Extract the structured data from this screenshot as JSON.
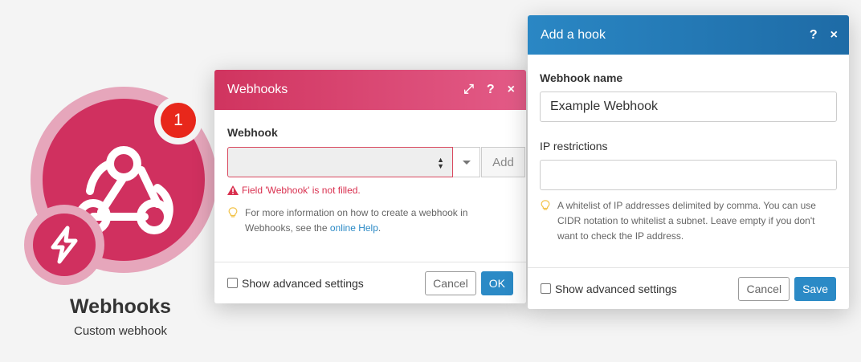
{
  "module": {
    "title": "Webhooks",
    "subtitle": "Custom webhook",
    "notification_count": "1",
    "color": "#d0305f",
    "icon": "webhook-icon"
  },
  "webhooks_dialog": {
    "title": "Webhooks",
    "header_buttons": {
      "expand": "⤢",
      "help": "?",
      "close": "×"
    },
    "webhook_label": "Webhook",
    "select_value": "",
    "add_button": "Add",
    "error_text": "Field 'Webhook' is not filled.",
    "hint_text_before_link": "For more information on how to create a webhook in Webhooks, see the ",
    "hint_link": "online Help",
    "hint_text_after_link": ".",
    "advanced_label": "Show advanced settings",
    "cancel_button": "Cancel",
    "ok_button": "OK"
  },
  "hook_dialog": {
    "title": "Add a hook",
    "header_buttons": {
      "help": "?",
      "close": "×"
    },
    "name_label": "Webhook name",
    "name_value": "Example Webhook",
    "ip_label": "IP restrictions",
    "ip_value": "",
    "ip_hint": "A whitelist of IP addresses delimited by comma. You can use CIDR notation to whitelist a subnet. Leave empty if you don't want to check the IP address.",
    "advanced_label": "Show advanced settings",
    "cancel_button": "Cancel",
    "save_button": "Save"
  },
  "colors": {
    "webhooks_accent": "#d0345f",
    "hook_accent": "#2a87c4",
    "error": "#d9304f",
    "primary_button": "#2b8ac6"
  }
}
